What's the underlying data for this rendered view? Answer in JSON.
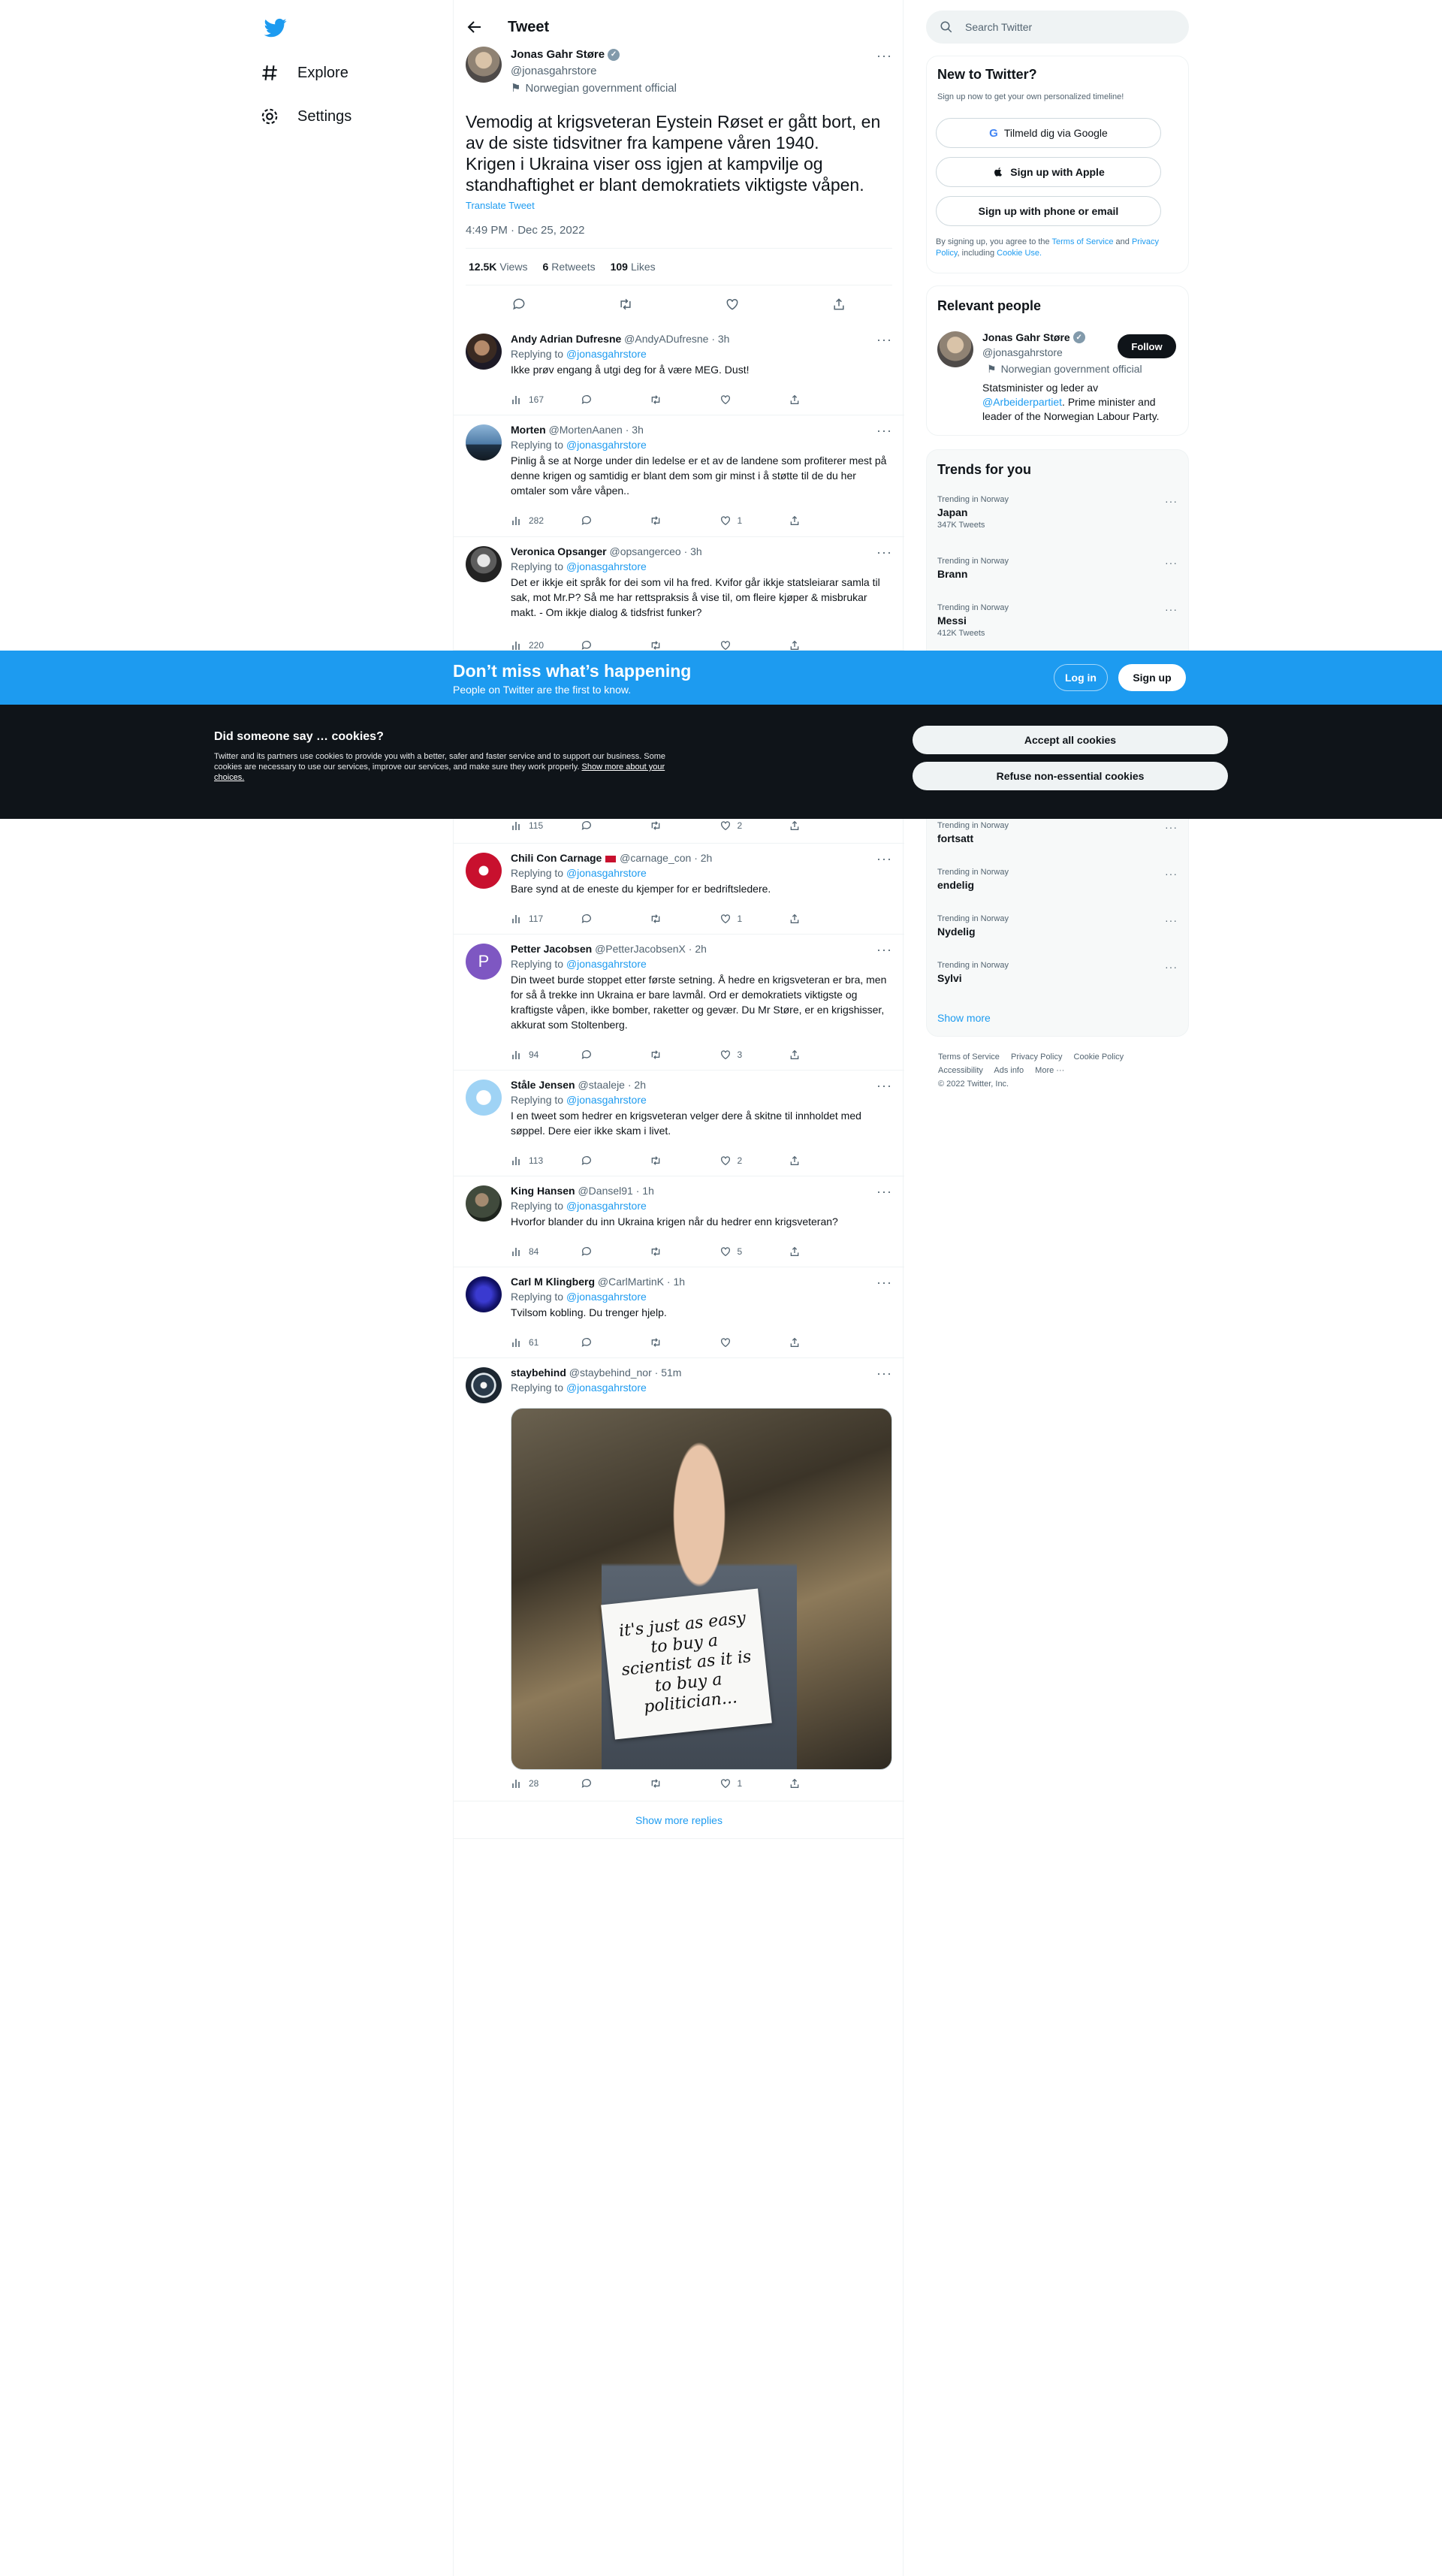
{
  "nav": {
    "items": [
      {
        "label": "Explore",
        "icon": "hashtag-icon"
      },
      {
        "label": "Settings",
        "icon": "gear-icon"
      }
    ]
  },
  "header": {
    "title": "Tweet"
  },
  "main_tweet": {
    "name": "Jonas Gahr Støre",
    "handle": "@jonasgahrstore",
    "label": "Norwegian government official",
    "text_line1": "Vemodig at krigsveteran Eystein Røset er gått bort, en av de siste tidsvitner fra kampene våren 1940.",
    "text_line2": "Krigen i Ukraina viser oss igjen at kampvilje og standhaftighet er blant demokratiets viktigste våpen.",
    "translate": "Translate Tweet",
    "time": "4:49 PM · Dec 25, 2022",
    "views": "12.5K",
    "views_label": "Views",
    "retweets": "6",
    "retweets_label": "Retweets",
    "likes": "109",
    "likes_label": "Likes"
  },
  "replying_label": "Replying to",
  "replying_handle": "@jonasgahrstore",
  "replies": [
    {
      "name": "Andy Adrian Dufresne",
      "handle": "@AndyADufresne",
      "time": "· 3h",
      "text": "Ikke prøv engang å utgi deg for å være MEG. Dust!",
      "views": "167",
      "likes": ""
    },
    {
      "name": "Morten",
      "handle": "@MortenAanen",
      "time": "· 3h",
      "text": "Pinlig å se at Norge under din ledelse er et av de landene som profiterer mest på denne krigen og samtidig er blant dem som gir minst i å støtte til de du her omtaler som våre våpen..",
      "views": "282",
      "likes": "1"
    },
    {
      "name": "Veronica Opsanger",
      "handle": "@opsangerceo",
      "time": "· 3h",
      "text": "Det er ikkje eit språk for dei som vil ha fred. Kvifor går ikkje statsleiarar samla til sak, mot Mr.P? Så me har rettspraksis å vise til, om fleire kjøper & misbrukar makt. - Om ikkje dialog & tidsfrist funker?",
      "views": "220",
      "likes": ""
    },
    {
      "name": "",
      "handle": "",
      "time": "",
      "text": "",
      "views": "115",
      "likes": "2"
    },
    {
      "name": "Chili Con Carnage",
      "handle": "@carnage_con",
      "time": "· 2h",
      "text": "Bare synd at de eneste du kjemper for er bedriftsledere.",
      "views": "117",
      "likes": "1"
    },
    {
      "name": "Petter Jacobsen",
      "handle": "@PetterJacobsenX",
      "time": "· 2h",
      "text": "Din tweet burde stoppet etter første setning. Å hedre en krigsveteran er bra, men for så å trekke inn Ukraina er bare lavmål. Ord er demokratiets viktigste og kraftigste våpen, ikke bomber, raketter og gevær. Du Mr Støre, er en krigshisser, akkurat som Stoltenberg.",
      "views": "94",
      "likes": "3"
    },
    {
      "name": "Ståle Jensen",
      "handle": "@staaleje",
      "time": "· 2h",
      "text": "I en tweet som hedrer en krigsveteran velger dere å skitne til innholdet med søppel. Dere eier ikke skam i livet.",
      "views": "113",
      "likes": "2"
    },
    {
      "name": "King Hansen",
      "handle": "@Dansel91",
      "time": "· 1h",
      "text": "Hvorfor blander du inn Ukraina krigen når du hedrer enn krigsveteran?",
      "views": "84",
      "likes": "5"
    },
    {
      "name": "Carl M Klingberg",
      "handle": "@CarlMartinK",
      "time": "· 1h",
      "text": "Tvilsom kobling. Du trenger hjelp.",
      "views": "61",
      "likes": ""
    },
    {
      "name": "staybehind",
      "handle": "@staybehind_nor",
      "time": "· 51m",
      "text": "",
      "views": "28",
      "likes": "1",
      "image_text": "it's just as easy to buy a scientist as it is to buy a politician..."
    }
  ],
  "show_more_replies": "Show more replies",
  "search": {
    "placeholder": "Search Twitter"
  },
  "new_to_twitter": {
    "title": "New to Twitter?",
    "subtitle": "Sign up now to get your own personalized timeline!",
    "google": "Tilmeld dig via Google",
    "apple": "Sign up with Apple",
    "phone": "Sign up with phone or email",
    "terms_1": "By signing up, you agree to the",
    "terms_link": "Terms of Service",
    "terms_2": "and",
    "privacy_link": "Privacy Policy",
    "terms_3": ", including",
    "cookie_link": "Cookie Use."
  },
  "relevant_people": {
    "title": "Relevant people",
    "name": "Jonas Gahr Støre",
    "handle": "@jonasgahrstore",
    "label": "Norwegian government official",
    "follow": "Follow",
    "bio_1": "Statsminister og leder av",
    "bio_link": "@Arbeiderpartiet",
    "bio_2": ". Prime minister and leader of the Norwegian Labour Party."
  },
  "trends": {
    "title": "Trends for you",
    "meta": "Trending in Norway",
    "items": [
      {
        "name": "Japan",
        "count": "347K Tweets"
      },
      {
        "name": "Brann",
        "count": ""
      },
      {
        "name": "Messi",
        "count": "412K Tweets"
      },
      {
        "name": "fortsatt",
        "count": ""
      },
      {
        "name": "endelig",
        "count": ""
      },
      {
        "name": "Nydelig",
        "count": ""
      },
      {
        "name": "Sylvi",
        "count": ""
      }
    ],
    "show_more": "Show more"
  },
  "footer": {
    "links": [
      "Terms of Service",
      "Privacy Policy",
      "Cookie Policy",
      "Accessibility",
      "Ads info",
      "More ···"
    ],
    "copyright": "© 2022 Twitter, Inc."
  },
  "signup_banner": {
    "title": "Don’t miss what’s happening",
    "subtitle": "People on Twitter are the first to know.",
    "login": "Log in",
    "signup": "Sign up"
  },
  "cookie_banner": {
    "title": "Did someone say … cookies?",
    "text": "Twitter and its partners use cookies to provide you with a better, safer and faster service and to support our business. Some cookies are necessary to use our services, improve our services, and make sure they work properly.",
    "link": "Show more about your choices.",
    "accept": "Accept all cookies",
    "refuse": "Refuse non-essential cookies"
  },
  "colors": {
    "accent": "#1d9bf0",
    "dark": "#0f1419",
    "muted": "#536471"
  }
}
